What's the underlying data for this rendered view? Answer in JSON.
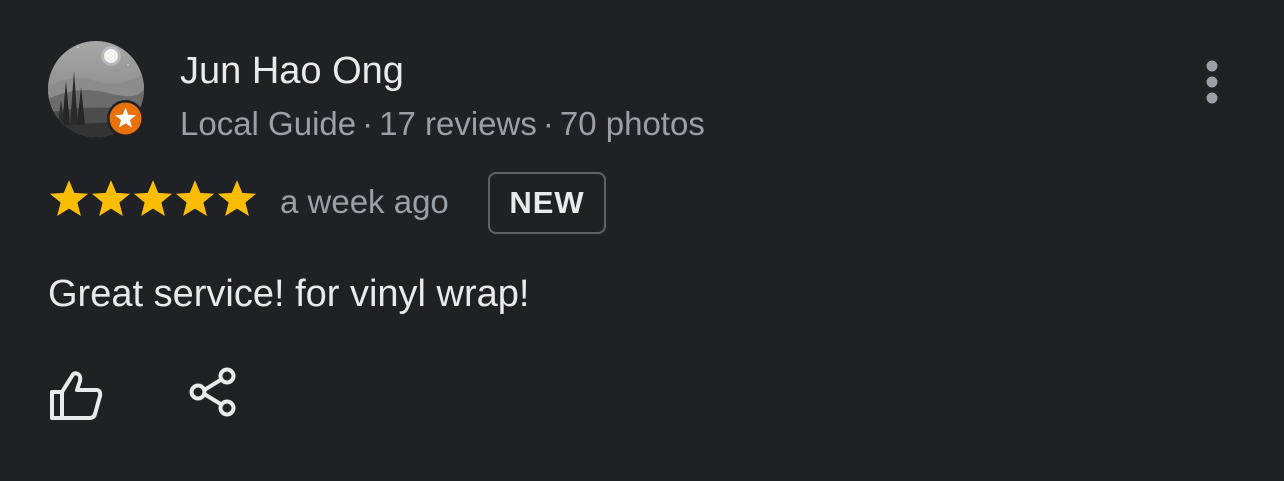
{
  "review": {
    "author": {
      "name": "Jun Hao Ong",
      "badge": "Local Guide",
      "reviews": "17 reviews",
      "photos": "70 photos",
      "separator": "·",
      "avatar_icon": "landscape-avatar-icon",
      "badge_icon": "local-guide-star-badge-icon"
    },
    "rating": {
      "stars": 5,
      "max": 5,
      "star_color": "#fbbc04"
    },
    "date": "a week ago",
    "new_label": "NEW",
    "text": "Great service! for vinyl wrap!",
    "actions": {
      "like_icon": "thumbs-up-icon",
      "share_icon": "share-icon",
      "more_icon": "more-vertical-icon"
    }
  },
  "colors": {
    "background": "#202124",
    "primary_text": "#e8eaed",
    "secondary_text": "#9aa0a6",
    "guide_badge": "#e8710a",
    "badge_border": "#5f6368"
  }
}
